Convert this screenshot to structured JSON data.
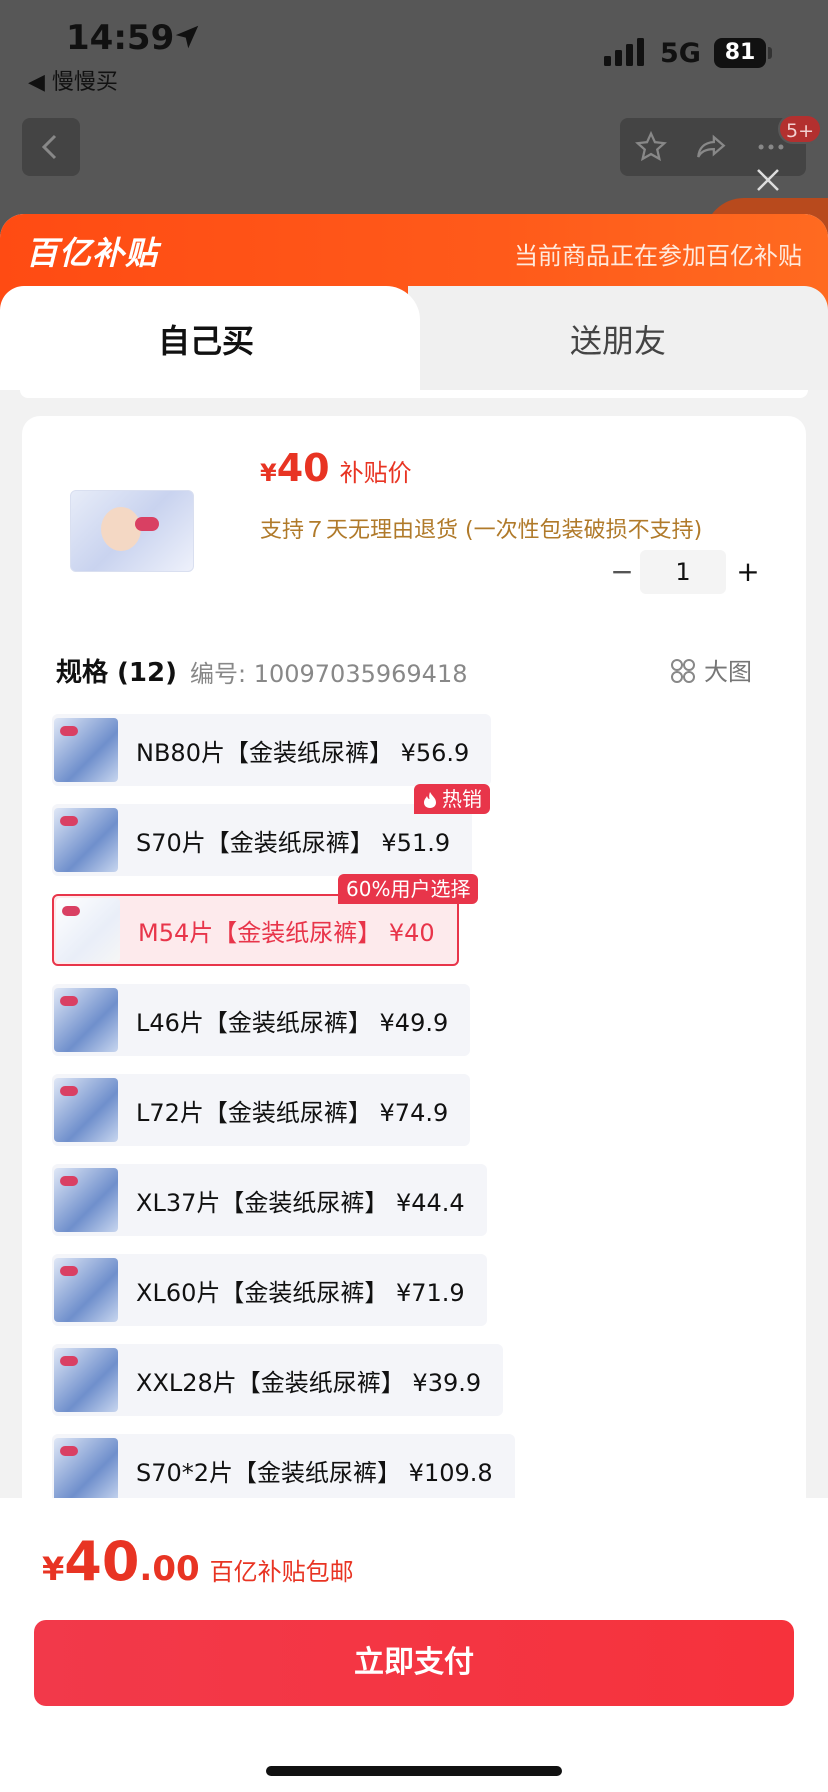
{
  "status_bar": {
    "time": "14:59",
    "back_app": "◀ 慢慢买",
    "network": "5G",
    "battery": "81"
  },
  "nav": {
    "badge": "5+"
  },
  "banner": {
    "logo": "百亿补贴",
    "note": "当前商品正在参加百亿补贴"
  },
  "tabs": [
    {
      "label": "自己买",
      "active": true
    },
    {
      "label": "送朋友",
      "active": false
    }
  ],
  "product": {
    "price_symbol": "¥",
    "price": "40",
    "price_tag": "补贴价",
    "return_note": "支持７天无理由退货 (一次性包装破损不支持)",
    "quantity": "1",
    "minus": "−",
    "plus": "+"
  },
  "spec": {
    "title": "规格 (12)",
    "code": "编号:  10097035969418",
    "big_view": "大图",
    "items": [
      {
        "label": "NB80片【金装纸尿裤】 ¥56.9"
      },
      {
        "label": "S70片【金装纸尿裤】 ¥51.9",
        "tag": "热销"
      },
      {
        "label": "M54片【金装纸尿裤】 ¥40",
        "tag": "60%用户选择",
        "selected": true
      },
      {
        "label": "L46片【金装纸尿裤】 ¥49.9"
      },
      {
        "label": "L72片【金装纸尿裤】 ¥74.9"
      },
      {
        "label": "XL37片【金装纸尿裤】 ¥44.4"
      },
      {
        "label": "XL60片【金装纸尿裤】 ¥71.9"
      },
      {
        "label": "XXL28片【金装纸尿裤】 ¥39.9"
      },
      {
        "label": "S70*2片【金装纸尿裤】 ¥109.8"
      }
    ]
  },
  "footer": {
    "total_symbol": "¥",
    "total_int": "40",
    "total_dec": ".00",
    "total_note": "百亿补贴包邮",
    "pay_label": "立即支付"
  },
  "colors": {
    "accent": "#e83423",
    "banner": "#ff5a1a",
    "pay_button": "#f2394a"
  }
}
